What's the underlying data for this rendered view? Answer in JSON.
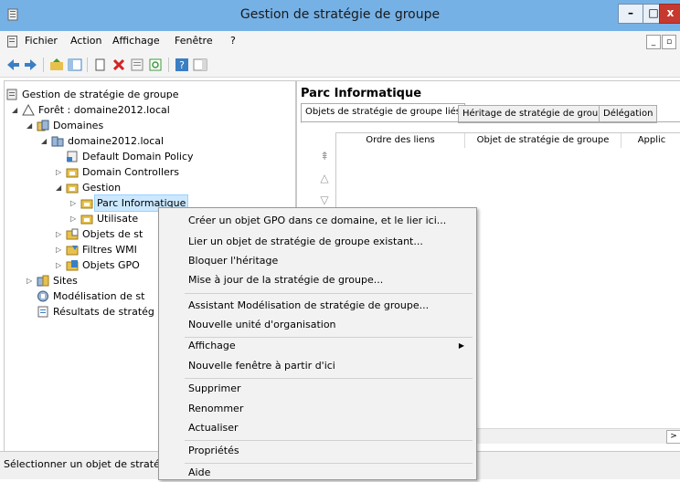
{
  "window": {
    "title": "Gestion de stratégie de groupe"
  },
  "menu": {
    "items": [
      "Fichier",
      "Action",
      "Affichage",
      "Fenêtre",
      "?"
    ]
  },
  "tree": {
    "nodes": [
      {
        "label": "Gestion de stratégie de groupe",
        "icon": "gpmc-icon"
      },
      {
        "label": "Forêt : domaine2012.local",
        "icon": "forest-icon",
        "expander": "open"
      },
      {
        "label": "Domaines",
        "icon": "domains-icon",
        "expander": "open"
      },
      {
        "label": "domaine2012.local",
        "icon": "domain-icon",
        "expander": "open"
      },
      {
        "label": "Default Domain Policy",
        "icon": "gpo-link-icon"
      },
      {
        "label": "Domain Controllers",
        "icon": "ou-icon",
        "expander": "closed"
      },
      {
        "label": "Gestion",
        "icon": "ou-icon",
        "expander": "open"
      },
      {
        "label": "Parc Informatique",
        "icon": "ou-icon",
        "expander": "closed",
        "selected": true
      },
      {
        "label": "Utilisate",
        "icon": "ou-icon",
        "expander": "closed"
      },
      {
        "label": "Objets de st",
        "icon": "gpo-folder-icon",
        "expander": "closed"
      },
      {
        "label": "Filtres WMI",
        "icon": "wmi-folder-icon",
        "expander": "closed"
      },
      {
        "label": "Objets GPO",
        "icon": "starter-gpo-icon",
        "expander": "closed"
      },
      {
        "label": "Sites",
        "icon": "sites-icon",
        "expander": "closed"
      },
      {
        "label": "Modélisation de st",
        "icon": "modeling-icon"
      },
      {
        "label": "Résultats de stratég",
        "icon": "results-icon"
      }
    ]
  },
  "right": {
    "title": "Parc Informatique",
    "tabs": [
      "Objets de stratégie de groupe liés",
      "Héritage de stratégie de groupe",
      "Délégation"
    ],
    "columns": [
      "Ordre des liens",
      "Objet de stratégie de groupe",
      "Applic"
    ]
  },
  "context_menu": {
    "items": [
      "Créer un objet GPO dans ce domaine, et le lier ici...",
      "Lier un objet de stratégie de groupe existant...",
      "Bloquer l'héritage",
      "Mise à jour de la stratégie de groupe...",
      "Assistant Modélisation de stratégie de groupe...",
      "Nouvelle unité d'organisation",
      "Affichage",
      "Nouvelle fenêtre à partir d'ici",
      "Supprimer",
      "Renommer",
      "Actualiser",
      "Propriétés",
      "Aide"
    ]
  },
  "status": {
    "text": "Sélectionner un objet de straté"
  }
}
